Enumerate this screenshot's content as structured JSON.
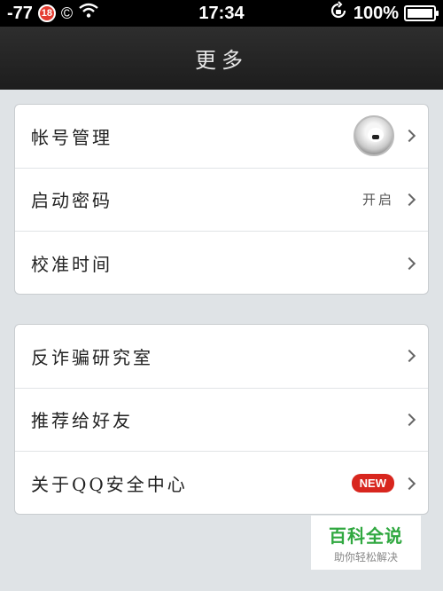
{
  "status_bar": {
    "signal": "-77",
    "age_badge": "18",
    "copyright_symbol": "©",
    "time": "17:34",
    "battery": "100%"
  },
  "nav": {
    "title": "更多"
  },
  "group1": [
    {
      "label": "帐号管理",
      "value": "",
      "has_avatar": true
    },
    {
      "label": "启动密码",
      "value": "开启"
    },
    {
      "label": "校准时间",
      "value": ""
    }
  ],
  "group2": [
    {
      "label": "反诈骗研究室"
    },
    {
      "label": "推荐给好友"
    },
    {
      "label": "关于QQ安全中心",
      "badge": "NEW"
    }
  ],
  "watermark": {
    "main": "百科全说",
    "sub": "助你轻松解决"
  }
}
